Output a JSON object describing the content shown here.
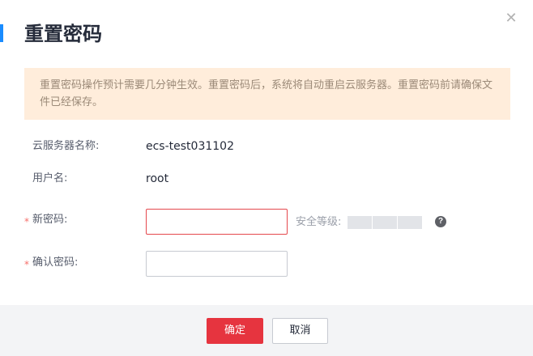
{
  "dialog": {
    "title": "重置密码",
    "close_icon": "close-icon",
    "notice": "重置密码操作预计需要几分钟生效。重置密码后，系统将自动重启云服务器。重置密码前请确保文件已经保存。"
  },
  "form": {
    "server_name_label": "云服务器名称:",
    "server_name_value": "ecs-test031102",
    "username_label": "用户名:",
    "username_value": "root",
    "required_mark": "*",
    "new_password_label": "新密码:",
    "new_password_value": "",
    "strength_label": "安全等级:",
    "strength_level": 0,
    "help_icon": "question-icon",
    "confirm_password_label": "确认密码:",
    "confirm_password_value": ""
  },
  "footer": {
    "confirm_label": "确定",
    "cancel_label": "取消"
  },
  "colors": {
    "accent": "#1a8cff",
    "notice_bg": "#ffeddb",
    "primary_button": "#e6343f",
    "error_border": "#e5484d"
  }
}
